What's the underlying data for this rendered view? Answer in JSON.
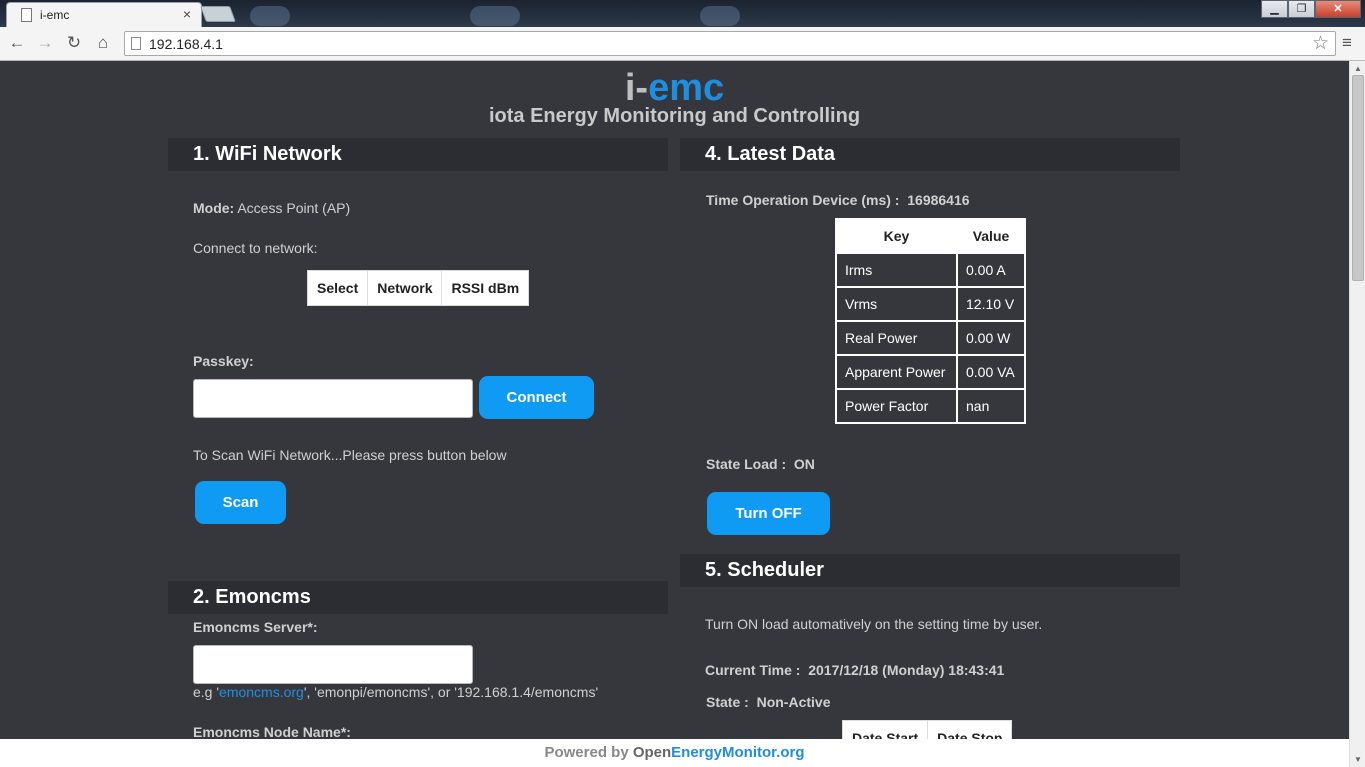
{
  "browser": {
    "tab_title": "i-emc",
    "tab_close": "×",
    "url": "192.168.4.1",
    "window_buttons": {
      "minimize": "▁",
      "maximize": "❐",
      "close": "✕"
    },
    "icons": {
      "back": "arrow-left",
      "forward": "arrow-right",
      "reload": "reload",
      "home": "home",
      "star": "star",
      "menu": "hamburger"
    }
  },
  "header": {
    "logo_part1": "i-",
    "logo_part2": "emc",
    "subtitle": "iota Energy Monitoring and Controlling"
  },
  "wifi": {
    "title": "1. WiFi Network",
    "mode_label": "Mode:",
    "mode_value": "Access Point (AP)",
    "connect_text": "Connect to network:",
    "table_headers": [
      "Select",
      "Network",
      "RSSI dBm"
    ],
    "passkey_label": "Passkey:",
    "passkey_value": "",
    "connect_button": "Connect",
    "scan_text": "To Scan WiFi Network...Please press button below",
    "scan_button": "Scan"
  },
  "emoncms": {
    "title": "2. Emoncms",
    "server_label": "Emoncms Server*:",
    "server_value": "",
    "example_prefix": "e.g '",
    "example_link": "emoncms.org",
    "example_suffix": "', 'emonpi/emoncms', or '192.168.1.4/emoncms'",
    "node_label": "Emoncms Node Name*:"
  },
  "latest": {
    "title": "4. Latest Data",
    "time_label": "Time Operation Device (ms) :",
    "time_value": "16986416",
    "table_headers": [
      "Key",
      "Value"
    ],
    "rows": [
      {
        "key": "Irms",
        "value": "0.00 A"
      },
      {
        "key": "Vrms",
        "value": "12.10 V"
      },
      {
        "key": "Real Power",
        "value": "0.00 W"
      },
      {
        "key": "Apparent Power",
        "value": "0.00 VA"
      },
      {
        "key": "Power Factor",
        "value": "nan"
      }
    ],
    "state_label": "State Load :",
    "state_value": "ON",
    "toggle_button": "Turn OFF"
  },
  "scheduler": {
    "title": "5. Scheduler",
    "description": "Turn ON load automatively on the setting time by user.",
    "current_time_label": "Current Time :",
    "current_time_value": "2017/12/18 (Monday) 18:43:41",
    "state_label": "State :",
    "state_value": "Non-Active",
    "table_headers": [
      "Date Start",
      "Date Stop"
    ]
  },
  "footer": {
    "part1": "Powered by ",
    "part2": "Open",
    "part3": "EnergyMonitor.org"
  },
  "colors": {
    "accent": "#0f9bf4",
    "page_bg": "#35373d",
    "section_bg": "#2b2d32",
    "logo_blue": "#1e8fe0"
  }
}
